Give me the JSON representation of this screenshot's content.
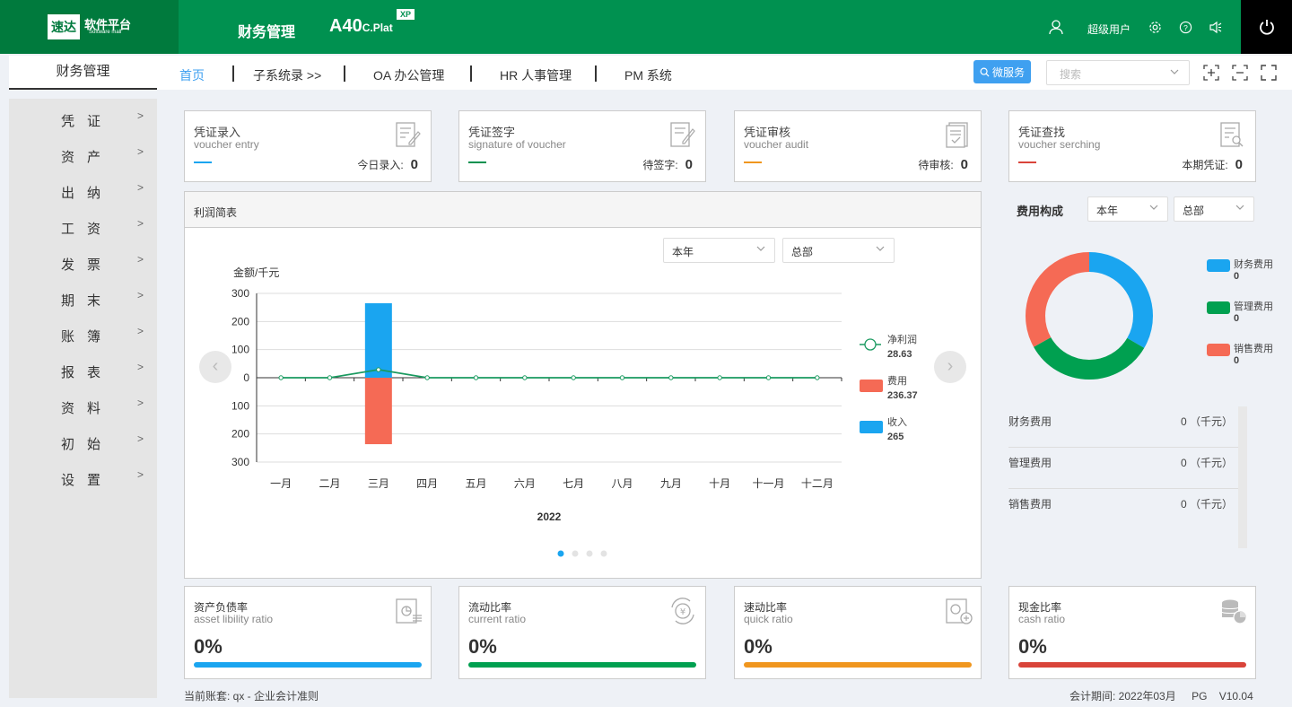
{
  "header": {
    "logo_mark": "速达",
    "logo_text": "软件平台",
    "logo_sub": "Software mall",
    "module_title": "财务管理",
    "product": "A40",
    "product_suffix": "C.Plat",
    "edition": "XP",
    "user": "超级用户"
  },
  "sidebar": {
    "title": "财务管理",
    "items": [
      "凭证",
      "资产",
      "出纳",
      "工资",
      "发票",
      "期末",
      "账簿",
      "报表",
      "资料",
      "初始",
      "设置"
    ]
  },
  "nav": {
    "tabs": [
      "首页",
      "子系统录 >>",
      "OA 办公管理",
      "HR 人事管理",
      "PM 系统"
    ],
    "micro_service": "微服务",
    "search_placeholder": "搜索"
  },
  "voucher_cards": [
    {
      "title": "凭证录入",
      "subtitle": "voucher entry",
      "count_label": "今日录入:",
      "count": "0",
      "color": "#1aa5f0"
    },
    {
      "title": "凭证签字",
      "subtitle": "signature of voucher",
      "count_label": "待签字:",
      "count": "0",
      "color": "#009150"
    },
    {
      "title": "凭证审核",
      "subtitle": "voucher audit",
      "count_label": "待审核:",
      "count": "0",
      "color": "#f0961e"
    },
    {
      "title": "凭证查找",
      "subtitle": "voucher serching",
      "count_label": "本期凭证:",
      "count": "0",
      "color": "#d9443a"
    }
  ],
  "profit": {
    "title": "利润简表",
    "period_select": "本年",
    "dept_select": "总部"
  },
  "chart_data": {
    "type": "bar",
    "ylabel": "金额/千元",
    "xlabel": "2022",
    "categories": [
      "一月",
      "二月",
      "三月",
      "四月",
      "五月",
      "六月",
      "七月",
      "八月",
      "九月",
      "十月",
      "十一月",
      "十二月"
    ],
    "yticks": [
      "300",
      "200",
      "100",
      "0",
      "100",
      "200",
      "300"
    ],
    "ylim": [
      -300,
      300
    ],
    "series": [
      {
        "name": "净利润",
        "type": "line",
        "color": "#1a9a60",
        "values": [
          0,
          0,
          28.63,
          0,
          0,
          0,
          0,
          0,
          0,
          0,
          0,
          0
        ],
        "legend_value": "28.63"
      },
      {
        "name": "费用",
        "type": "bar",
        "color": "#f56a55",
        "values": [
          0,
          0,
          -236.37,
          0,
          0,
          0,
          0,
          0,
          0,
          0,
          0,
          0
        ],
        "legend_value": "236.37"
      },
      {
        "name": "收入",
        "type": "bar",
        "color": "#1aa5f0",
        "values": [
          0,
          0,
          265,
          0,
          0,
          0,
          0,
          0,
          0,
          0,
          0,
          0
        ],
        "legend_value": "265"
      }
    ]
  },
  "fee": {
    "title": "费用构成",
    "period_select": "本年",
    "dept_select": "总部",
    "legend": [
      {
        "name": "财务费用",
        "value": "0",
        "color": "#1aa5f0"
      },
      {
        "name": "管理费用",
        "value": "0",
        "color": "#00a050"
      },
      {
        "name": "销售费用",
        "value": "0",
        "color": "#f56a55"
      }
    ],
    "rows": [
      {
        "name": "财务费用",
        "value": "0 （千元）"
      },
      {
        "name": "管理费用",
        "value": "0 （千元）"
      },
      {
        "name": "销售费用",
        "value": "0 （千元）"
      }
    ]
  },
  "ratio_cards": [
    {
      "title": "资产负债率",
      "subtitle": "asset libility ratio",
      "value": "0%",
      "color": "#1aa5f0"
    },
    {
      "title": "流动比率",
      "subtitle": "current ratio",
      "value": "0%",
      "color": "#00a050"
    },
    {
      "title": "速动比率",
      "subtitle": "quick ratio",
      "value": "0%",
      "color": "#f0961e"
    },
    {
      "title": "现金比率",
      "subtitle": "cash ratio",
      "value": "0%",
      "color": "#d9443a"
    }
  ],
  "footer": {
    "account": "当前账套: qx - 企业会计准则",
    "period": "会计期间: 2022年03月",
    "pg": "PG",
    "version": "V10.04"
  }
}
